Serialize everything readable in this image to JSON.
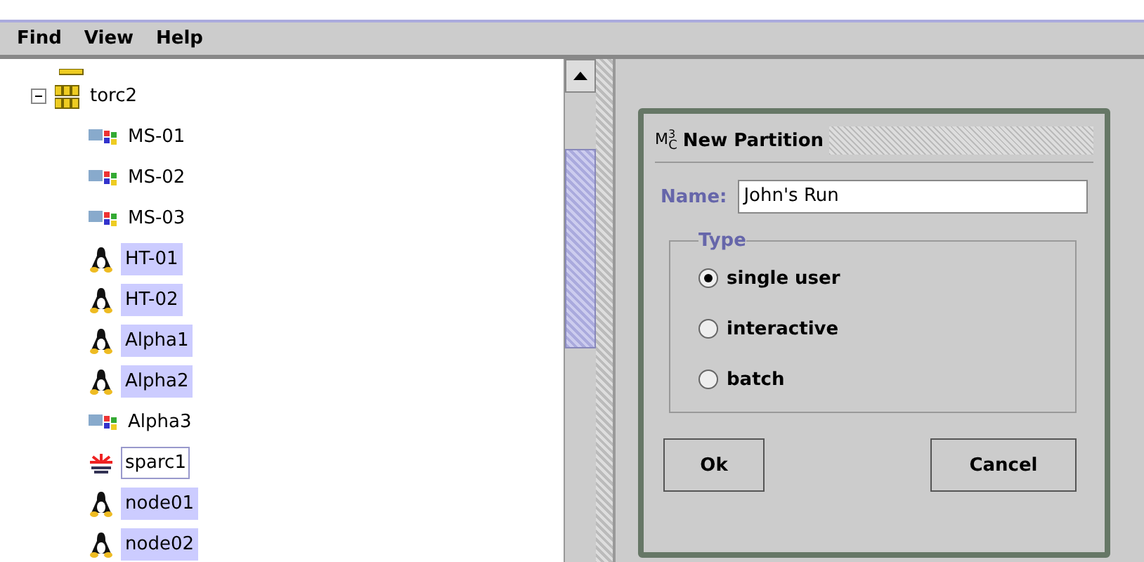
{
  "menu": [
    {
      "label": "Find"
    },
    {
      "label": "View"
    },
    {
      "label": "Help"
    }
  ],
  "tree": {
    "label": "torc2",
    "expanded": true,
    "children": [
      {
        "label": "MS-01",
        "kind": "windows",
        "selected": false,
        "focused": false
      },
      {
        "label": "MS-02",
        "kind": "windows",
        "selected": false,
        "focused": false
      },
      {
        "label": "MS-03",
        "kind": "windows",
        "selected": false,
        "focused": false
      },
      {
        "label": "HT-01",
        "kind": "linux",
        "selected": true,
        "focused": false
      },
      {
        "label": "HT-02",
        "kind": "linux",
        "selected": true,
        "focused": false
      },
      {
        "label": "Alpha1",
        "kind": "linux",
        "selected": true,
        "focused": false
      },
      {
        "label": "Alpha2",
        "kind": "linux",
        "selected": true,
        "focused": false
      },
      {
        "label": "Alpha3",
        "kind": "windows",
        "selected": false,
        "focused": false
      },
      {
        "label": "sparc1",
        "kind": "sun",
        "selected": false,
        "focused": true
      },
      {
        "label": "node01",
        "kind": "linux",
        "selected": true,
        "focused": false
      },
      {
        "label": "node02",
        "kind": "linux",
        "selected": true,
        "focused": false
      }
    ]
  },
  "dialog": {
    "logo": "M$^{3}$$_{C}$",
    "title": "New Partition",
    "name_label": "Name:",
    "name_value": "John's Run",
    "group_title": "Type",
    "options": [
      {
        "label": "single user",
        "selected": true
      },
      {
        "label": "interactive",
        "selected": false
      },
      {
        "label": "batch",
        "selected": false
      }
    ],
    "buttons": [
      {
        "label": "Ok"
      },
      {
        "label": "Cancel"
      }
    ]
  }
}
